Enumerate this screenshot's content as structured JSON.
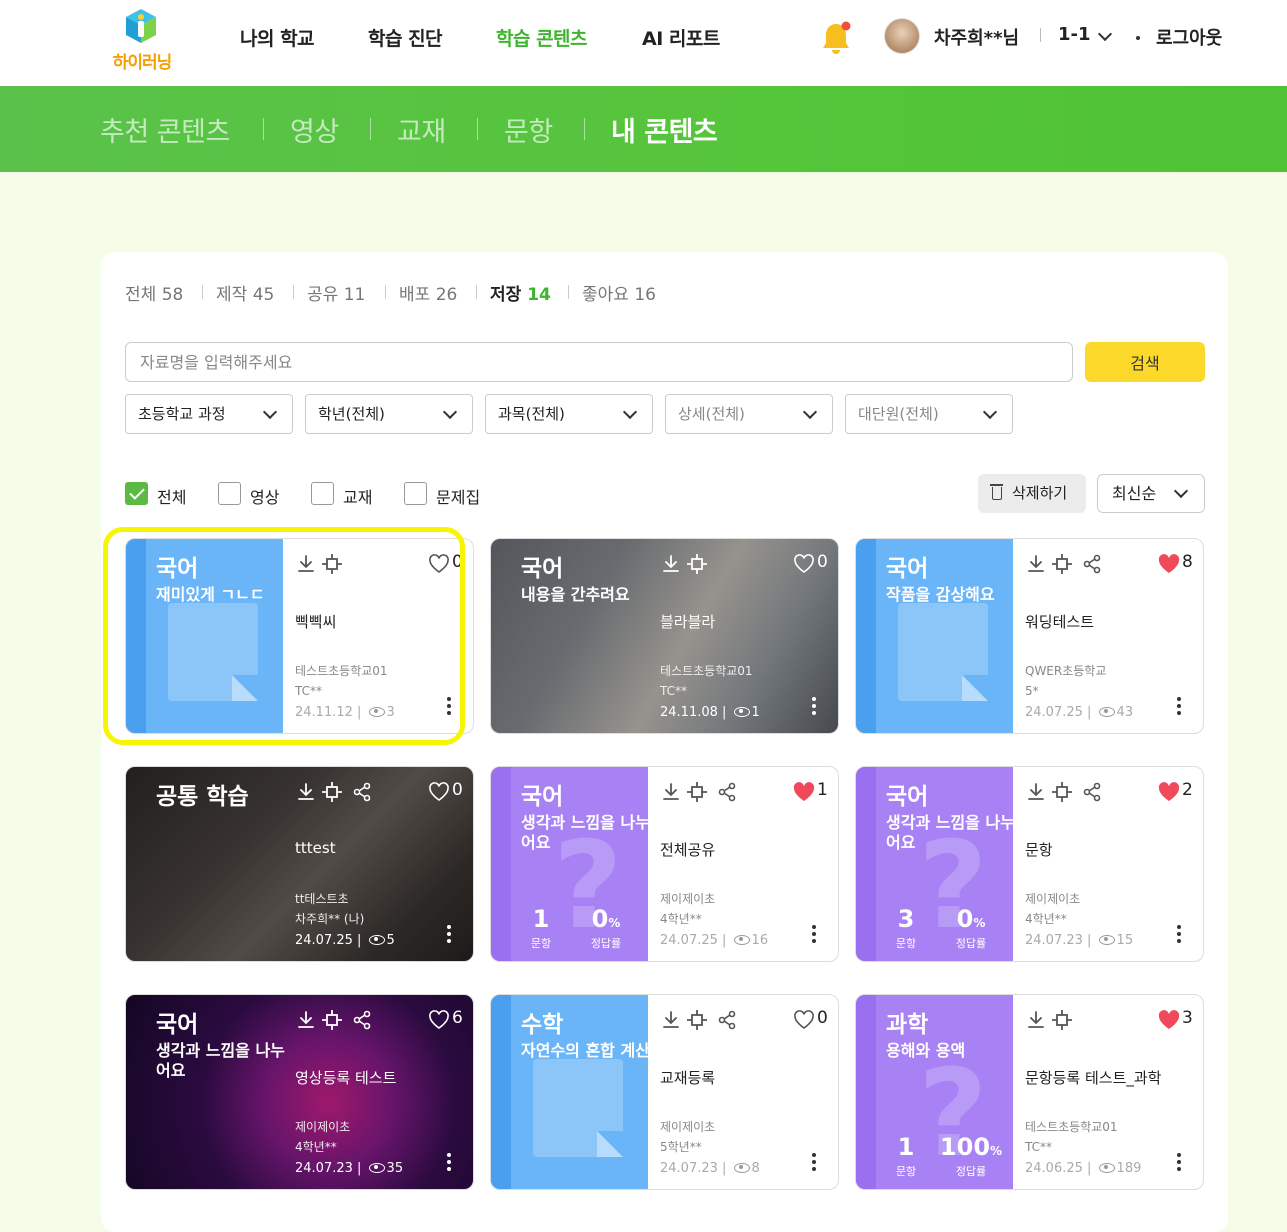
{
  "brand": {
    "name": "하이러닝"
  },
  "nav": {
    "items": [
      "나의 학교",
      "학습 진단",
      "학습 콘텐츠",
      "AI 리포트"
    ],
    "active": "학습 콘텐츠"
  },
  "user": {
    "name": "차주희**님",
    "class": "1-1",
    "logout": "로그아웃"
  },
  "subnav": {
    "tabs": [
      "추천 콘텐츠",
      "영상",
      "교재",
      "문항",
      "내 콘텐츠"
    ],
    "active": "내 콘텐츠"
  },
  "filter_tabs": [
    {
      "label": "전체",
      "count": "58"
    },
    {
      "label": "제작",
      "count": "45"
    },
    {
      "label": "공유",
      "count": "11"
    },
    {
      "label": "배포",
      "count": "26"
    },
    {
      "label": "저장",
      "count": "14"
    },
    {
      "label": "좋아요",
      "count": "16"
    }
  ],
  "active_filter_tab": "저장",
  "search": {
    "placeholder": "자료명을 입력해주세요",
    "value": "",
    "button": "검색"
  },
  "selects": [
    "초등학교 과정",
    "학년(전체)",
    "과목(전체)",
    "상세(전체)",
    "대단원(전체)"
  ],
  "type_checks": [
    {
      "label": "전체",
      "checked": true
    },
    {
      "label": "영상",
      "checked": false
    },
    {
      "label": "교재",
      "checked": false
    },
    {
      "label": "문제집",
      "checked": false
    }
  ],
  "delete_label": "삭제하기",
  "sort": "최신순",
  "colors": {
    "accent": "#3fb42e",
    "green_bar": "#55c53a",
    "search_button": "#fcd82a",
    "book": "#69b5f8",
    "quiz": "#a882f5",
    "like": "#f0495a",
    "highlight": "#f8f500"
  },
  "cards": [
    {
      "kind": "book",
      "subject": "국어",
      "unit": "재미있게 ㄱㄴㄷ",
      "title": "삑삑씨",
      "school": "테스트초등학교01",
      "grade": "TC**",
      "date": "24.11.12",
      "views": "3",
      "likes": "0",
      "liked": false,
      "share": false,
      "highlighted": true
    },
    {
      "kind": "video",
      "scene": "lab",
      "subject": "국어",
      "unit": "내용을 간추려요",
      "title": "블라블라",
      "school": "테스트초등학교01",
      "grade": "TC**",
      "date": "24.11.08",
      "views": "1",
      "likes": "0",
      "liked": false,
      "share": false
    },
    {
      "kind": "book",
      "subject": "국어",
      "unit": "작품을 감상해요",
      "title": "워딩테스트",
      "school": "QWER초등학교",
      "grade": "5*",
      "date": "24.07.25",
      "views": "43",
      "likes": "8",
      "liked": true,
      "share": true
    },
    {
      "kind": "video",
      "scene": "desk",
      "subject": "공통 학습",
      "unit": "",
      "title": "tttest",
      "school": "tt테스트초",
      "grade": "차주희** (나)",
      "date": "24.07.25",
      "views": "5",
      "likes": "0",
      "liked": false,
      "share": true
    },
    {
      "kind": "quiz",
      "subject": "국어",
      "unit": "생각과 느낌을 나누어요",
      "title": "전체공유",
      "school": "제이제이초",
      "grade": "4학년**",
      "date": "24.07.25",
      "views": "16",
      "likes": "1",
      "liked": true,
      "share": true,
      "questions": "1",
      "rate": "0",
      "q_label": "문항",
      "r_label": "정답률"
    },
    {
      "kind": "quiz",
      "subject": "국어",
      "unit": "생각과 느낌을 나누어요",
      "title": "문항",
      "school": "제이제이초",
      "grade": "4학년**",
      "date": "24.07.23",
      "views": "15",
      "likes": "2",
      "liked": true,
      "share": true,
      "questions": "3",
      "rate": "0",
      "q_label": "문항",
      "r_label": "정답률"
    },
    {
      "kind": "video",
      "scene": "chip",
      "subject": "국어",
      "unit": "생각과 느낌을 나누어요",
      "title": "영상등록 테스트",
      "school": "제이제이초",
      "grade": "4학년**",
      "date": "24.07.23",
      "views": "35",
      "likes": "6",
      "liked": false,
      "share": true
    },
    {
      "kind": "book",
      "subject": "수학",
      "unit": "자연수의 혼합 계산",
      "title": "교재등록",
      "school": "제이제이초",
      "grade": "5학년**",
      "date": "24.07.23",
      "views": "8",
      "likes": "0",
      "liked": false,
      "share": true
    },
    {
      "kind": "quiz",
      "subject": "과학",
      "unit": "용해와 용액",
      "title": "문항등록 테스트_과학",
      "school": "테스트초등학교01",
      "grade": "TC**",
      "date": "24.06.25",
      "views": "189",
      "likes": "3",
      "liked": true,
      "share": false,
      "questions": "1",
      "rate": "100",
      "q_label": "문항",
      "r_label": "정답률"
    }
  ]
}
